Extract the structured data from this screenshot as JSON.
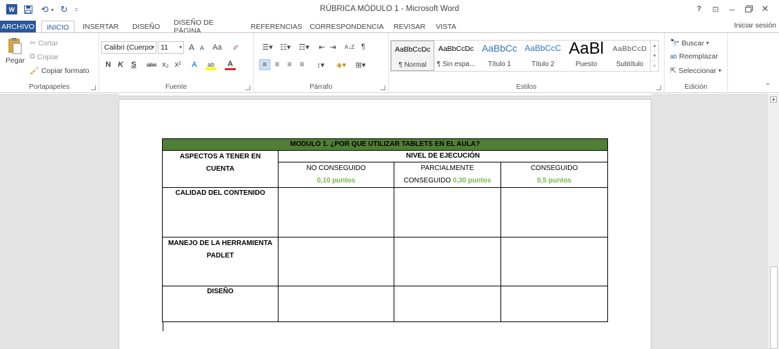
{
  "window": {
    "title": "RÚBRICA MÓDULO 1 - Microsoft Word",
    "app_icon": "W",
    "quick_access": [
      "save-icon",
      "undo-icon",
      "redo-icon",
      "customize-icon"
    ],
    "controls": {
      "help": "?",
      "restore_ribbon": "⊡",
      "minimize": "–",
      "maximize": "🗗",
      "close": "✕"
    }
  },
  "tabs": {
    "file": "ARCHIVO",
    "home": "INICIO",
    "insert": "INSERTAR",
    "design": "DISEÑO",
    "layout": "DISEÑO DE PÁGINA",
    "references": "REFERENCIAS",
    "mailings": "CORRESPONDENCIA",
    "review": "REVISAR",
    "view": "VISTA",
    "signin": "Iniciar sesión"
  },
  "ribbon": {
    "clipboard": {
      "label": "Portapapeles",
      "paste": "Pegar",
      "cut": "Cortar",
      "copy": "Copiar",
      "format_painter": "Copiar formato"
    },
    "font": {
      "label": "Fuente",
      "font_name": "Calibri (Cuerpo",
      "font_size": "11",
      "grow": "A",
      "shrink": "A",
      "case": "Aa",
      "bold": "N",
      "italic": "K",
      "underline": "S",
      "strike": "abc",
      "subscript": "x₂",
      "superscript": "x²",
      "effects": "A",
      "highlight": "ab",
      "color": "A"
    },
    "paragraph": {
      "label": "Párrafo",
      "sort": "A↓Z",
      "pilcrow": "¶"
    },
    "styles": {
      "label": "Estilos",
      "items": [
        {
          "preview": "AaBbCcDc",
          "name": "¶ Normal"
        },
        {
          "preview": "AaBbCcDc",
          "name": "¶ Sin espa..."
        },
        {
          "preview": "AaBbCc",
          "name": "Título 1"
        },
        {
          "preview": "AaBbCcC",
          "name": "Título 2"
        },
        {
          "preview": "AaBl",
          "name": "Puesto"
        },
        {
          "preview": "AaBbCcD",
          "name": "Subtítulo"
        }
      ]
    },
    "editing": {
      "label": "Edición",
      "find": "Buscar",
      "replace": "Reemplazar",
      "select": "Seleccionar"
    }
  },
  "rubric": {
    "title": "MODULO 1. ¿POR QUE UTILIZAR TABLETS EN EL AULA?",
    "aspects_header": "ASPECTOS A TENER EN CUENTA",
    "level_header": "NIVEL DE EJECUCIÓN",
    "levels": [
      {
        "name": "NO CONSEGUIDO",
        "points": "0,10 puntos"
      },
      {
        "name": "PARCIALMENTE CONSEGUIDO",
        "points": "0,30 puntos"
      },
      {
        "name": "CONSEGUIDO",
        "points": "0,5 puntos"
      }
    ],
    "criteria": [
      "CALIDAD DEL CONTENIDO",
      "MANEJO DE LA HERRAMIENTA PADLET",
      "DISEÑO"
    ]
  },
  "colors": {
    "word_blue": "#2b579a",
    "header_green": "#4f7f34",
    "points_green": "#74b94a"
  }
}
